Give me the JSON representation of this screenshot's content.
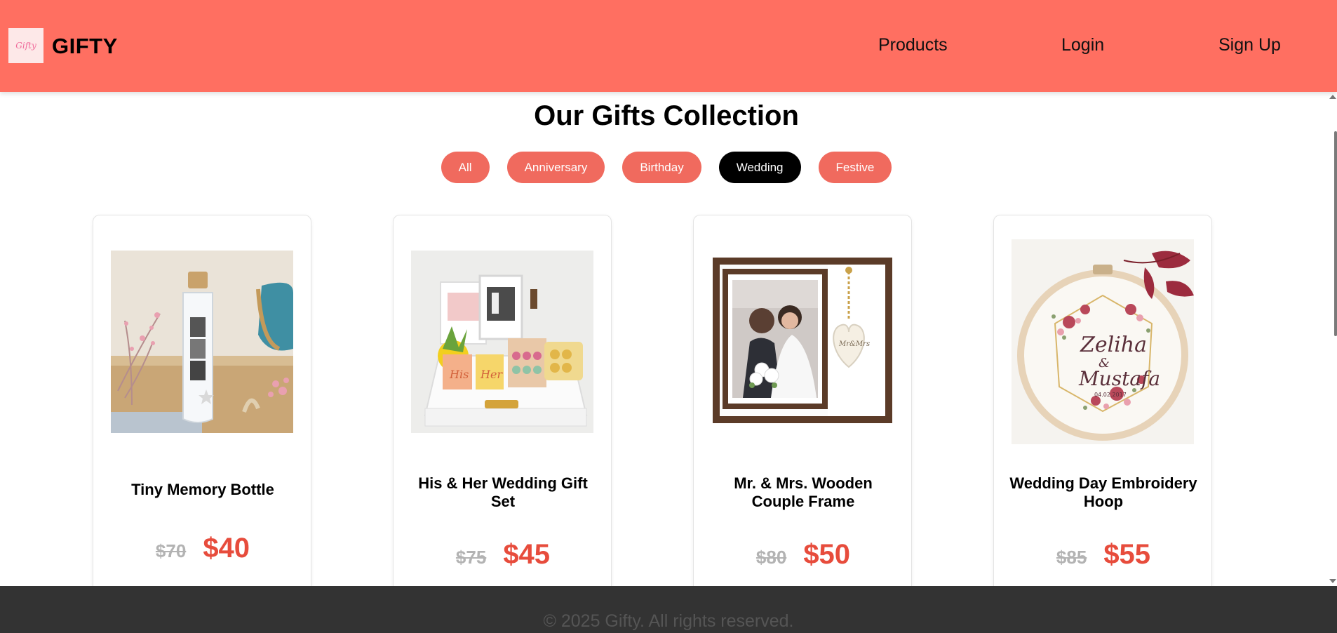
{
  "header": {
    "logo_text": "Gifty",
    "brand": "GIFTY",
    "nav": [
      "Products",
      "Login",
      "Sign Up"
    ]
  },
  "main": {
    "title": "Our Gifts Collection",
    "filters": [
      "All",
      "Anniversary",
      "Birthday",
      "Wedding",
      "Festive"
    ],
    "active_filter": "Wedding",
    "products": [
      {
        "name": "Tiny Memory Bottle",
        "old_price": "$70",
        "price": "$40"
      },
      {
        "name": "His & Her Wedding Gift Set",
        "old_price": "$75",
        "price": "$45"
      },
      {
        "name": "Mr. & Mrs. Wooden Couple Frame",
        "old_price": "$80",
        "price": "$50"
      },
      {
        "name": "Wedding Day Embroidery Hoop",
        "old_price": "$85",
        "price": "$55"
      }
    ]
  },
  "footer": {
    "text": "© 2025 Gifty. All rights reserved."
  },
  "colors": {
    "header_bg": "#ff6f61",
    "pill_bg": "#f06a5e",
    "pill_active_bg": "#000000",
    "price": "#e74c3c",
    "old_price": "#b3b3b3",
    "footer_bg": "#333333"
  }
}
